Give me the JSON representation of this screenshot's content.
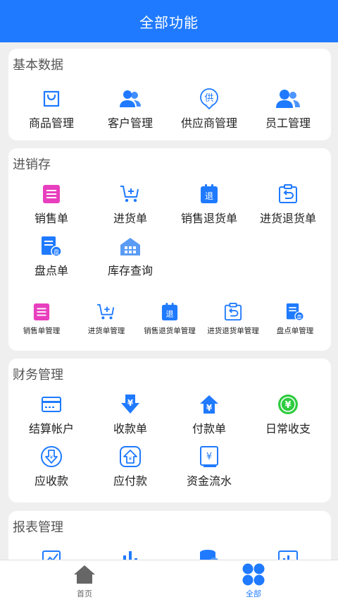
{
  "header": {
    "title": "全部功能"
  },
  "colors": {
    "primary": "#1f7aff",
    "magenta": "#e83fbe",
    "green": "#2ecc40",
    "nav_inactive": "#666666"
  },
  "sections": {
    "basic": {
      "title": "基本数据",
      "items": [
        {
          "label": "商品管理",
          "icon": "shopping-bag-icon"
        },
        {
          "label": "客户管理",
          "icon": "customers-icon"
        },
        {
          "label": "供应商管理",
          "icon": "supplier-icon",
          "glyph": "供"
        },
        {
          "label": "员工管理",
          "icon": "employees-icon"
        }
      ]
    },
    "inventory": {
      "title": "进销存",
      "items": [
        {
          "label": "销售单",
          "icon": "sales-order-icon"
        },
        {
          "label": "进货单",
          "icon": "purchase-cart-icon"
        },
        {
          "label": "销售退货单",
          "icon": "sales-return-icon",
          "glyph": "退"
        },
        {
          "label": "进货退货单",
          "icon": "purchase-return-icon"
        },
        {
          "label": "盘点单",
          "icon": "stocktake-icon",
          "glyph": "盘"
        },
        {
          "label": "库存查询",
          "icon": "warehouse-icon"
        }
      ],
      "management": [
        {
          "label": "销售单管理",
          "icon": "sales-order-icon"
        },
        {
          "label": "进货单管理",
          "icon": "purchase-cart-icon"
        },
        {
          "label": "销售退货单管理",
          "icon": "sales-return-icon",
          "glyph": "退"
        },
        {
          "label": "进货退货单管理",
          "icon": "purchase-return-icon"
        },
        {
          "label": "盘点单管理",
          "icon": "stocktake-icon",
          "glyph": "盘"
        }
      ]
    },
    "finance": {
      "title": "财务管理",
      "items": [
        {
          "label": "结算帐户",
          "icon": "card-icon"
        },
        {
          "label": "收款单",
          "icon": "receive-payment-icon",
          "glyph": "¥"
        },
        {
          "label": "付款单",
          "icon": "make-payment-icon",
          "glyph": "¥"
        },
        {
          "label": "日常收支",
          "icon": "daily-expense-icon",
          "glyph": "¥"
        },
        {
          "label": "应收款",
          "icon": "receivable-icon",
          "glyph": "¥"
        },
        {
          "label": "应付款",
          "icon": "payable-icon",
          "glyph": "¥"
        },
        {
          "label": "资金流水",
          "icon": "fund-flow-icon",
          "glyph": "¥"
        }
      ]
    },
    "reports": {
      "title": "报表管理",
      "items": [
        {
          "icon": "trend-chart-icon"
        },
        {
          "icon": "bar-chart-icon"
        },
        {
          "icon": "coins-report-icon"
        },
        {
          "icon": "chart-board-icon"
        }
      ]
    }
  },
  "bottom_nav": {
    "items": [
      {
        "label": "首页",
        "icon": "home-icon",
        "active": false
      },
      {
        "label": "全部",
        "icon": "all-grid-icon",
        "active": true
      }
    ]
  }
}
